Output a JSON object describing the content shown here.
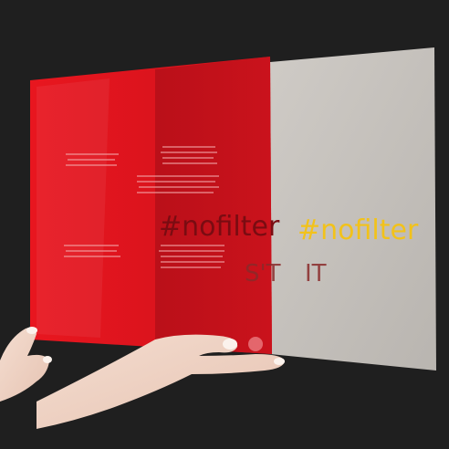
{
  "scene": {
    "hashtag_red_panel": "#nofilter",
    "hashtag_clear_panel": "#nofilter",
    "hidden_text_left": "S'T",
    "hidden_text_right": "IT",
    "colors": {
      "background": "#1f1f1f",
      "red_panel": "#e0141c",
      "red_panel_dark": "#b3101a",
      "clear_panel": "#c7c3bd",
      "hashtag_red": "#7a0c12",
      "hashtag_yellow": "#f2c21a",
      "hidden_text": "#8a2a2a"
    }
  }
}
